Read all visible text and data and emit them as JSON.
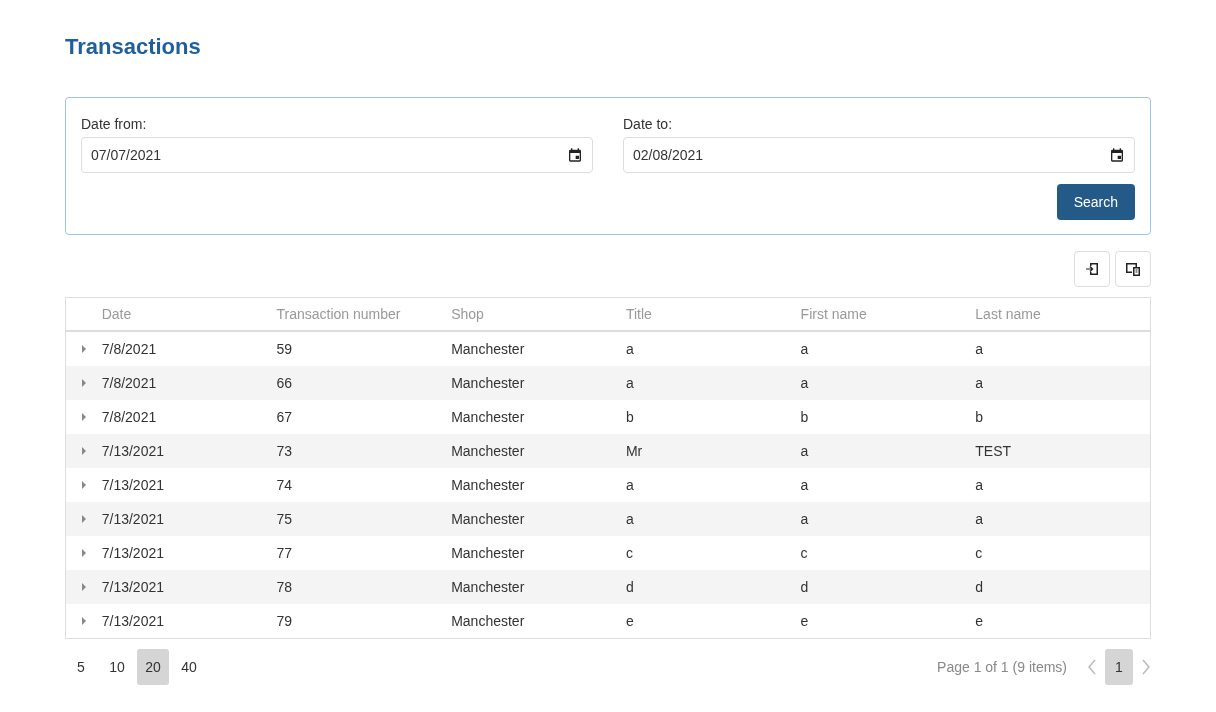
{
  "title": "Transactions",
  "filters": [
    {
      "label": "Date from:",
      "value": "07/07/2021"
    },
    {
      "label": "Date to:",
      "value": "02/08/2021"
    }
  ],
  "search_button": "Search",
  "table": {
    "columns": [
      "Date",
      "Transaction number",
      "Shop",
      "Title",
      "First name",
      "Last name"
    ],
    "rows": [
      {
        "expanded": false,
        "cells": [
          "7/8/2021",
          "59",
          "Manchester",
          "a",
          "a",
          "a"
        ]
      },
      {
        "expanded": false,
        "cells": [
          "7/8/2021",
          "66",
          "Manchester",
          "a",
          "a",
          "a"
        ]
      },
      {
        "expanded": false,
        "cells": [
          "7/8/2021",
          "67",
          "Manchester",
          "b",
          "b",
          "b"
        ]
      },
      {
        "expanded": false,
        "cells": [
          "7/13/2021",
          "73",
          "Manchester",
          "Mr",
          "a",
          "TEST"
        ]
      },
      {
        "expanded": false,
        "cells": [
          "7/13/2021",
          "74",
          "Manchester",
          "a",
          "a",
          "a"
        ]
      },
      {
        "expanded": false,
        "cells": [
          "7/13/2021",
          "75",
          "Manchester",
          "a",
          "a",
          "a"
        ]
      },
      {
        "expanded": false,
        "cells": [
          "7/13/2021",
          "77",
          "Manchester",
          "c",
          "c",
          "c"
        ]
      },
      {
        "expanded": false,
        "cells": [
          "7/13/2021",
          "78",
          "Manchester",
          "d",
          "d",
          "d"
        ]
      },
      {
        "expanded": false,
        "cells": [
          "7/13/2021",
          "79",
          "Manchester",
          "e",
          "e",
          "e"
        ]
      }
    ]
  },
  "page_sizes": [
    {
      "label": "5",
      "selected": false
    },
    {
      "label": "10",
      "selected": false
    },
    {
      "label": "20",
      "selected": true
    },
    {
      "label": "40",
      "selected": false
    }
  ],
  "page_info": "Page 1 of 1 (9 items)",
  "pages": [
    {
      "label": "1",
      "selected": true
    }
  ]
}
